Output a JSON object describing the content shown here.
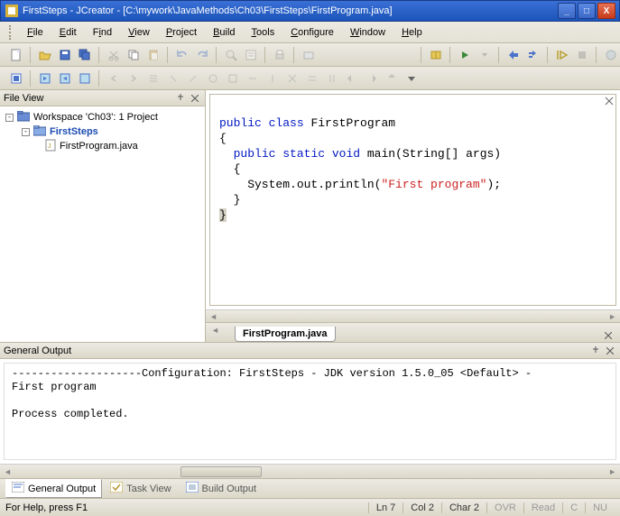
{
  "titlebar": {
    "title": "FirstSteps - JCreator - [C:\\mywork\\JavaMethods\\Ch03\\FirstSteps\\FirstProgram.java]"
  },
  "menu": {
    "file": "File",
    "edit": "Edit",
    "find": "Find",
    "view": "View",
    "project": "Project",
    "build": "Build",
    "tools": "Tools",
    "configure": "Configure",
    "window": "Window",
    "help": "Help"
  },
  "fileview": {
    "header": "File View",
    "workspace": "Workspace 'Ch03': 1 Project",
    "project": "FirstSteps",
    "file": "FirstProgram.java"
  },
  "code": {
    "l1a": "public",
    "l1b": "class",
    "l1c": " FirstProgram",
    "l2": "{",
    "l3a": "public",
    "l3b": "static",
    "l3c": "void",
    "l3d": " main(String[] args)",
    "l4": "  {",
    "l5a": "    System.out.println(",
    "l5b": "\"First program\"",
    "l5c": ");",
    "l6": "  }",
    "l7": "}"
  },
  "editor_tab": "FirstProgram.java",
  "output": {
    "header": "General Output",
    "line1": "--------------------Configuration: FirstSteps - JDK version 1.5.0_05 <Default> -",
    "line2": "First program",
    "line3": "",
    "line4": "Process completed."
  },
  "bottomtabs": {
    "general": "General Output",
    "task": "Task View",
    "build": "Build Output"
  },
  "status": {
    "help": "For Help, press F1",
    "ln": "Ln 7",
    "col": "Col 2",
    "char": "Char 2",
    "ovr": "OVR",
    "read": "Read",
    "caps": "C",
    "num": "NU"
  },
  "icons": {
    "app": "jc",
    "close": "×",
    "max": "❐",
    "min": "–"
  }
}
